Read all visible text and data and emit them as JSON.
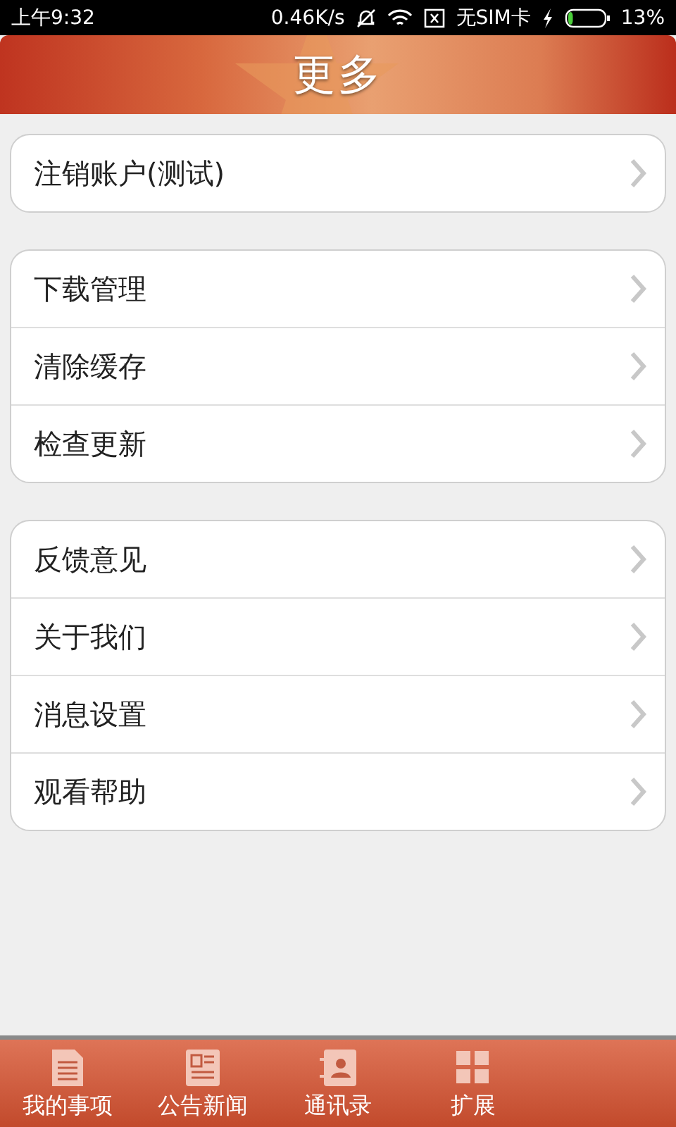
{
  "status_bar": {
    "time": "上午9:32",
    "speed": "0.46K/s",
    "sim": "无SIM卡",
    "level": 0.13,
    "battery": "13%"
  },
  "header": {
    "title": "更多"
  },
  "groups": [
    {
      "items": [
        {
          "label": "注销账户(测试)"
        }
      ]
    },
    {
      "items": [
        {
          "label": "下载管理"
        },
        {
          "label": "清除缓存"
        },
        {
          "label": "检查更新"
        }
      ]
    },
    {
      "items": [
        {
          "label": "反馈意见"
        },
        {
          "label": "关于我们"
        },
        {
          "label": "消息设置"
        },
        {
          "label": "观看帮助"
        }
      ]
    }
  ],
  "tab_bar": [
    {
      "label": "我的事项",
      "kind": "document"
    },
    {
      "label": "公告新闻",
      "kind": "news"
    },
    {
      "label": "通讯录",
      "kind": "contacts"
    },
    {
      "label": "扩展",
      "kind": "grid"
    }
  ]
}
